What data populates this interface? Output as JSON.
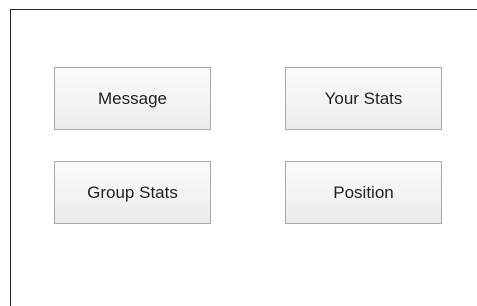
{
  "buttons": {
    "message": "Message",
    "your_stats": "Your Stats",
    "group_stats": "Group Stats",
    "position": "Position"
  }
}
